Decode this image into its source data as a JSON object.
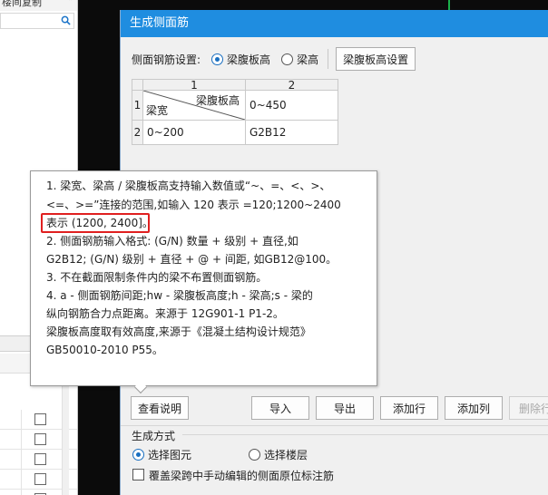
{
  "left_panel": {
    "title": "楼间复制",
    "chevron": "»",
    "search_icon": "search-icon",
    "rows": 5
  },
  "dialog": {
    "title": "生成侧面筋",
    "settings_label": "侧面钢筋设置:",
    "radio_web_height": "梁腹板高",
    "radio_beam_height": "梁高",
    "web_height_button": "梁腹板高设置",
    "selected_setting": "梁腹板高"
  },
  "table": {
    "col1": "1",
    "col2": "2",
    "row1": "1",
    "row2": "2",
    "diag_top": "梁腹板高",
    "diag_bottom": "梁宽",
    "r1c2": "0~450",
    "r2c1": "0~200",
    "r2c2": "G2B12"
  },
  "tooltip": {
    "lines": [
      "1. 梁宽、梁高 / 梁腹板高支持输入数值或“~、=、<、>、",
      "<=、>=”连接的范围,如输入 120 表示 =120;1200~2400",
      "表示 (1200, 2400]。",
      "2. 侧面钢筋输入格式: (G/N) 数量 + 级别 + 直径,如",
      "G2B12; (G/N) 级别 + 直径 + @ + 间距, 如GB12@100。",
      "3. 不在截面限制条件内的梁不布置侧面钢筋。",
      "4. a - 侧面钢筋间距;hw - 梁腹板高度;h - 梁高;s - 梁的",
      "纵向钢筋合力点距离。来源于 12G901-1 P1-2。",
      "梁腹板高度取有效高度,来源于《混凝土结构设计规范》",
      "GB50010-2010 P55。"
    ]
  },
  "buttons": {
    "view_help": "查看说明",
    "import": "导入",
    "export": "导出",
    "add_row": "添加行",
    "add_col": "添加列",
    "delete_row": "删除行"
  },
  "generate": {
    "section_title": "生成方式",
    "select_element": "选择图元",
    "select_floor": "选择楼层",
    "selected": "选择图元",
    "overwrite_label": "覆盖梁跨中手动编辑的侧面原位标注筋",
    "overwrite_checked": false
  },
  "colors": {
    "title_bar": "#1f8de0",
    "highlight": "#e02020",
    "radio_accent": "#1a6fc0"
  }
}
